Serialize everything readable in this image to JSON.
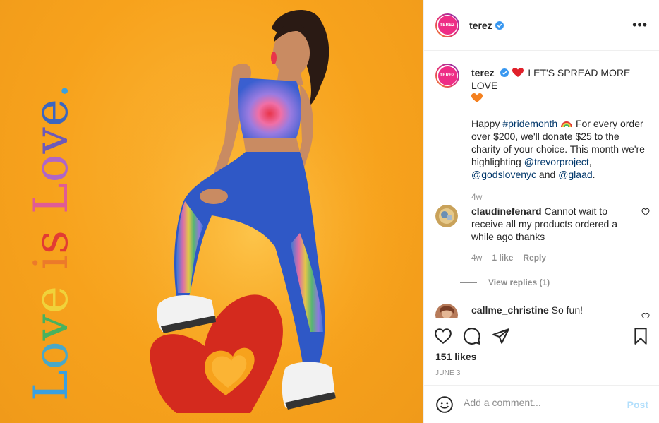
{
  "post": {
    "image": {
      "vertical_text": "Love is Love.",
      "brand_colors": [
        "#3aa0e0",
        "#4aa8c8",
        "#49b25e",
        "#f0d23a",
        "#ec7a2a",
        "#e23b33",
        "#e05b95",
        "#b066c6",
        "#6e5ab8",
        "#3b66c0"
      ]
    },
    "author": {
      "avatar_text": "TEREZ",
      "username": "terez",
      "verified": true
    },
    "caption": {
      "username": "terez",
      "line1_pre": "LET'S SPREAD MORE LOVE",
      "paragraph": {
        "t1": "Happy ",
        "hashtag": "#pridemonth",
        "t2": " For every order over $200, we'll donate $25 to the charity of your choice. This month we're highlighting ",
        "mention1": "@trevorproject",
        "t3": ", ",
        "mention2": "@godslovenyc",
        "t4": " and ",
        "mention3": "@glaad",
        "t5": "."
      },
      "time": "4w"
    },
    "comments": [
      {
        "username": "claudinefenard",
        "text": "Cannot wait to receive all my products ordered a while ago thanks",
        "time": "4w",
        "likes": "1 like",
        "reply_label": "Reply",
        "view_replies": "View replies (1)"
      },
      {
        "username": "callme_christine",
        "text": "So fun!"
      }
    ],
    "likes": "151 likes",
    "date": "JUNE 3",
    "add_comment": {
      "placeholder": "Add a comment...",
      "post_label": "Post"
    }
  }
}
